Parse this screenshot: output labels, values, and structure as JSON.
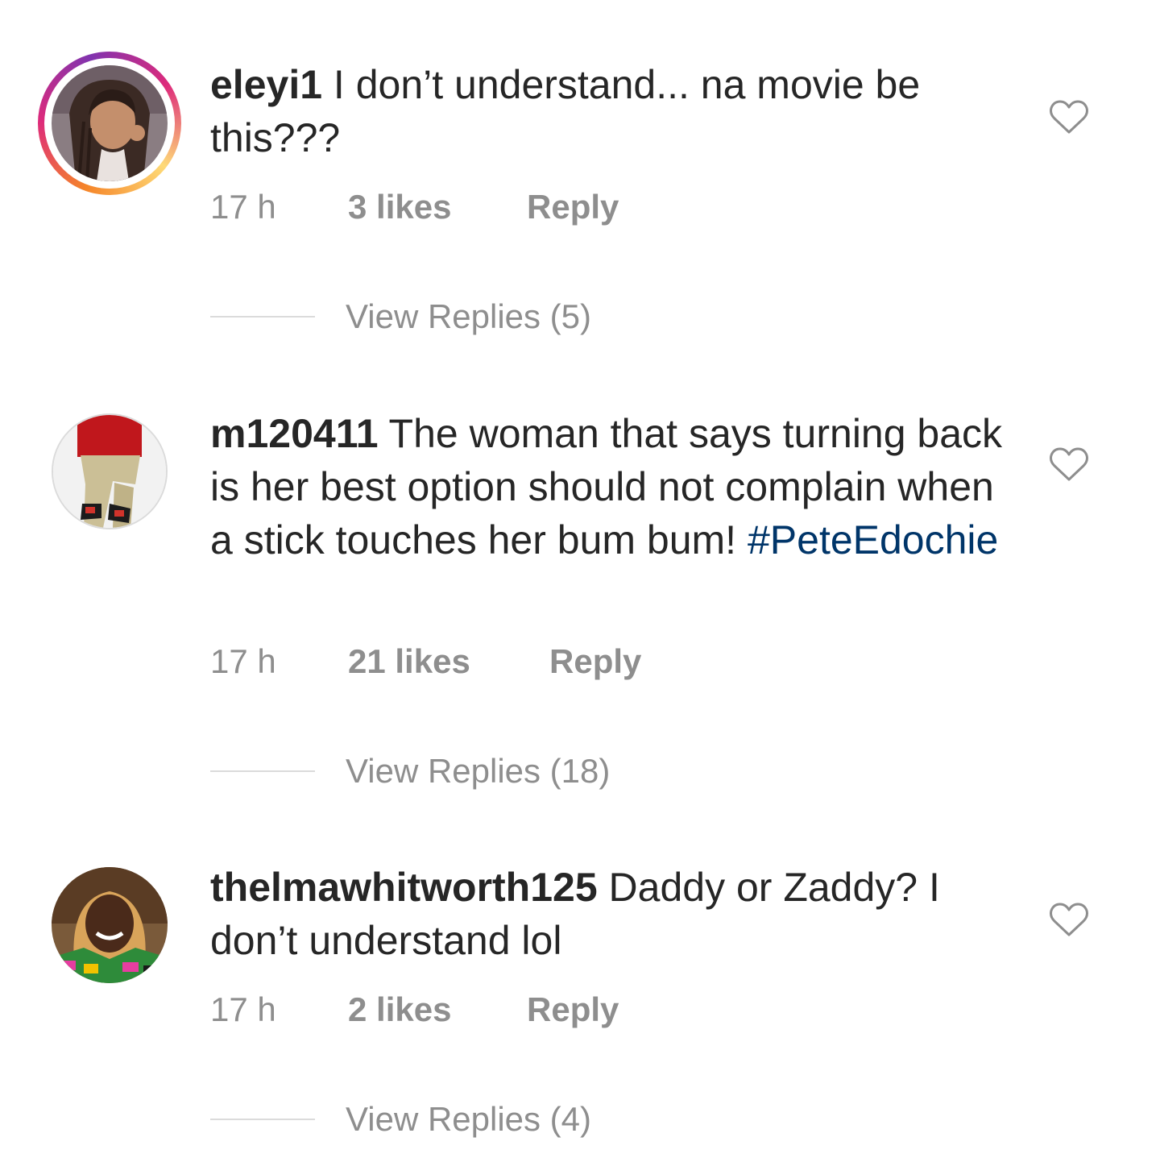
{
  "comments": [
    {
      "username": "eleyi1",
      "text": "I don’t understand... na movie be this???",
      "hashtag": "",
      "time": "17 h",
      "likes": "3 likes",
      "reply_label": "Reply",
      "view_replies": "View Replies (5)",
      "story_ring": true,
      "avatar_icon": "woman-with-braids-avatar"
    },
    {
      "username": "m120411",
      "text": "The woman that says turning back is her best option should not complain when a stick touches her bum bum!",
      "hashtag": "#PeteEdochie",
      "time": "17 h",
      "likes": "21 likes",
      "reply_label": "Reply",
      "view_replies": "View Replies (18)",
      "story_ring": false,
      "avatar_icon": "legs-sneakers-avatar"
    },
    {
      "username": "thelmawhitworth125",
      "text": "Daddy or Zaddy? I don’t understand lol",
      "hashtag": "",
      "time": "17 h",
      "likes": "2 likes",
      "reply_label": "Reply",
      "view_replies": "View Replies (4)",
      "story_ring": false,
      "avatar_icon": "smiling-woman-avatar"
    }
  ],
  "colors": {
    "text": "#262626",
    "meta": "#8e8e8e",
    "hashtag": "#003569",
    "divider": "#dbdbdb",
    "heart": "#8e8e8e"
  },
  "icons": {
    "like": "heart-outline-icon"
  }
}
